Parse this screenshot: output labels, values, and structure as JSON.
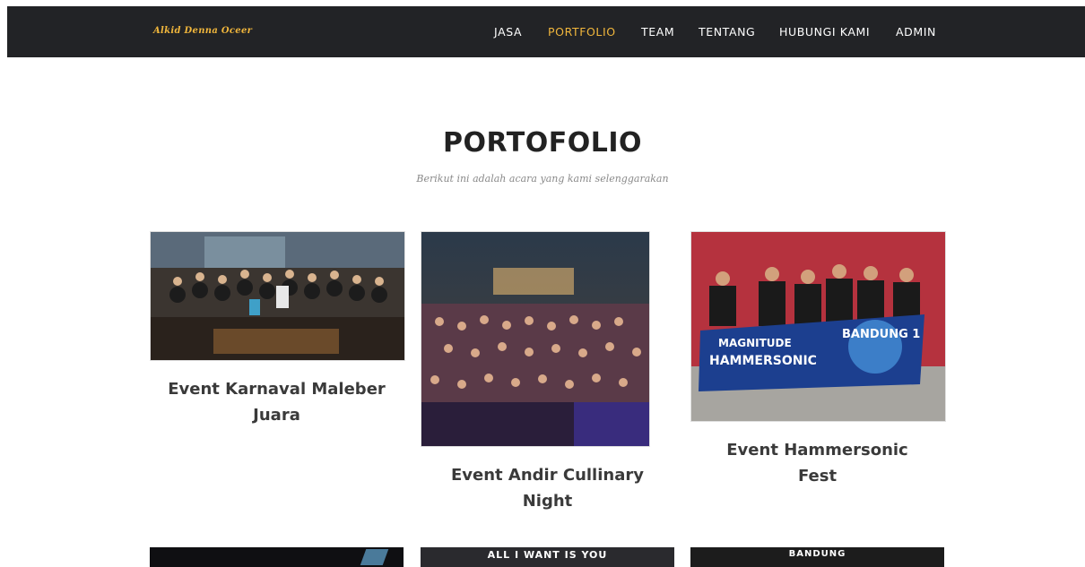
{
  "navbar": {
    "brand": "Alkid Denna Oceer",
    "items": [
      {
        "label": "JASA",
        "active": false
      },
      {
        "label": "PORTFOLIO",
        "active": true
      },
      {
        "label": "TEAM",
        "active": false
      },
      {
        "label": "TENTANG",
        "active": false
      },
      {
        "label": "HUBUNGI KAMI",
        "active": false
      },
      {
        "label": "ADMIN",
        "active": false
      }
    ]
  },
  "portfolio": {
    "title": "PORTOFOLIO",
    "subtitle": "Berikut ini adalah acara yang kami selenggarakan",
    "items": [
      {
        "caption_line1": "Event Karnaval Maleber",
        "caption_line2": "Juara"
      },
      {
        "caption_line1": "Event Andir Cullinary",
        "caption_line2": "Night"
      },
      {
        "caption_line1": "Event Hammersonic",
        "caption_line2": "Fest",
        "banner_left": "MAGNITUDE",
        "banner_left2": "HAMMERSONIC",
        "banner_right": "BANDUNG 1"
      }
    ],
    "next_row": [
      {
        "text": ""
      },
      {
        "text": "ALL I WANT IS YOU"
      },
      {
        "text": "BANDUNG"
      }
    ]
  }
}
